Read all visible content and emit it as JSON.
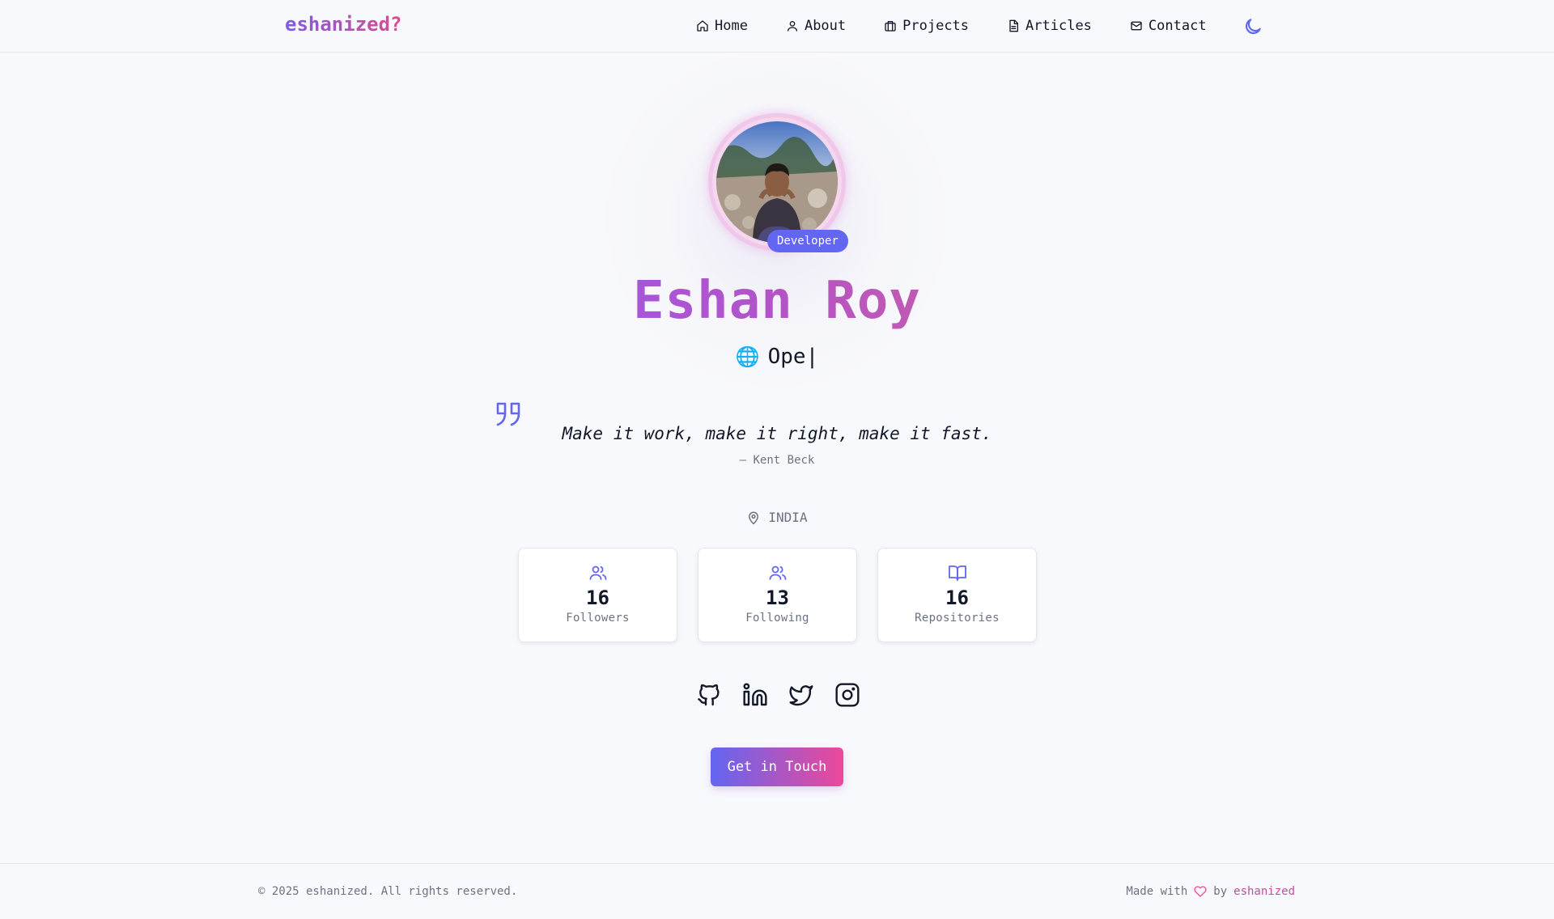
{
  "header": {
    "logo": "eshanized?",
    "nav": [
      {
        "label": "Home",
        "icon": "home-icon"
      },
      {
        "label": "About",
        "icon": "user-icon"
      },
      {
        "label": "Projects",
        "icon": "briefcase-icon"
      },
      {
        "label": "Articles",
        "icon": "document-icon"
      },
      {
        "label": "Contact",
        "icon": "mail-icon"
      }
    ],
    "theme_toggle_icon": "moon-icon"
  },
  "hero": {
    "badge": "Developer",
    "name": "Eshan Roy",
    "typed_emoji": "🌐",
    "typed_text": "Ope|",
    "quote": "Make it work, make it right, make it fast.",
    "quote_author": "— Kent Beck",
    "location": "INDIA"
  },
  "stats": [
    {
      "value": "16",
      "label": "Followers",
      "icon": "users-icon"
    },
    {
      "value": "13",
      "label": "Following",
      "icon": "users-icon"
    },
    {
      "value": "16",
      "label": "Repositories",
      "icon": "book-icon"
    }
  ],
  "social": [
    "github-icon",
    "linkedin-icon",
    "twitter-icon",
    "instagram-icon"
  ],
  "cta_label": "Get in Touch",
  "footer": {
    "copyright": "© 2025 eshanized. All rights reserved.",
    "made_with": "Made with",
    "by": "by",
    "author": "eshanized"
  },
  "colors": {
    "accent": "#6366f1",
    "pink": "#ec4899",
    "background": "#f8f9fc"
  }
}
